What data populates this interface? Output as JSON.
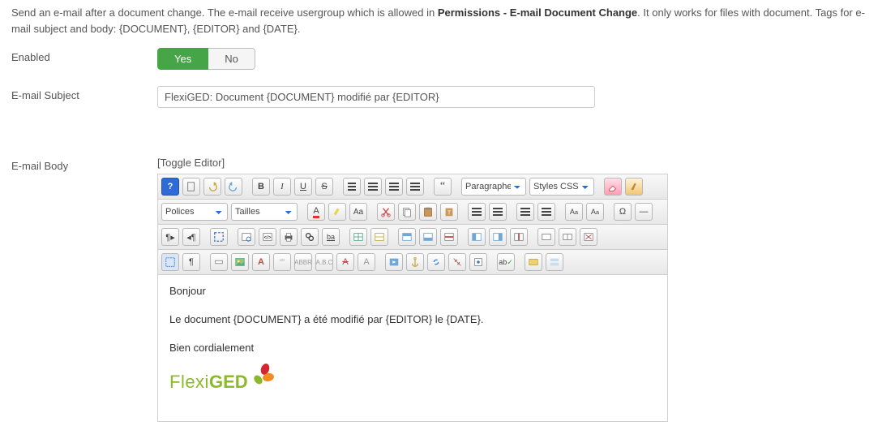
{
  "description": {
    "pre": "Send an e-mail after a document change. The e-mail receive usergroup which is allowed in ",
    "bold": "Permissions - E-mail Document Change",
    "post": ". It only works for files with document. Tags for e-mail subject and body: {DOCUMENT}, {EDITOR} and {DATE}."
  },
  "labels": {
    "enabled": "Enabled",
    "subject": "E-mail Subject",
    "body": "E-mail Body"
  },
  "enabled": {
    "yes": "Yes",
    "no": "No",
    "value": "Yes"
  },
  "subject_value": "FlexiGED: Document {DOCUMENT} modifié par {EDITOR}",
  "toggle_editor": "[Toggle Editor]",
  "toolbar": {
    "paragraph_label": "Paragraphe",
    "styles_label": "Styles CSS",
    "fonts_label": "Polices",
    "sizes_label": "Tailles",
    "bold": "B",
    "italic": "I",
    "underline": "U",
    "strike": "S",
    "sub": "x₂",
    "sup": "x²",
    "omega": "Ω"
  },
  "body": {
    "line1": "Bonjour",
    "line2": "Le document {DOCUMENT} a été modifié par {EDITOR} le {DATE}.",
    "line3": "Bien cordialement",
    "logo": {
      "flexi": "Flexi",
      "ged": "GED"
    }
  }
}
